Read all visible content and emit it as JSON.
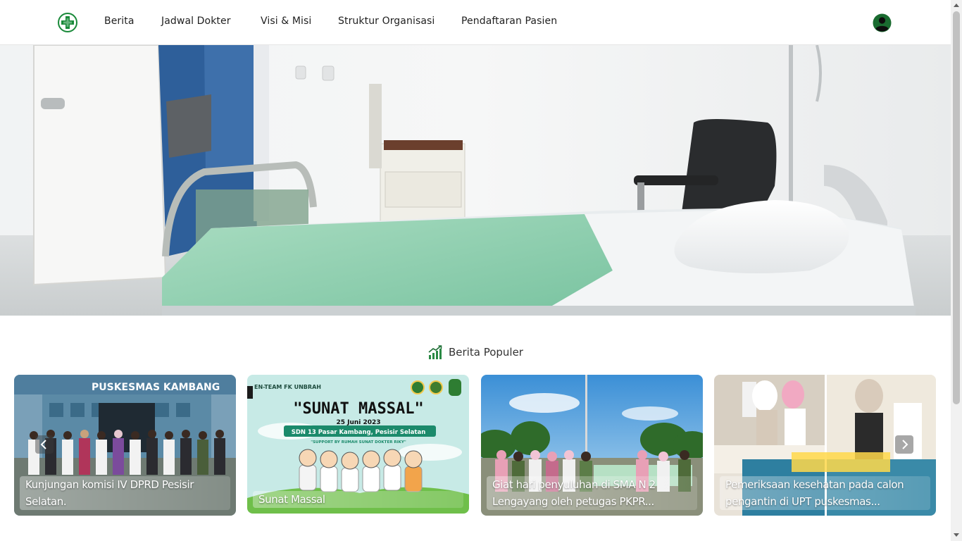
{
  "nav": {
    "logo_icon": "medical-cross-icon",
    "items": [
      "Berita",
      "Jadwal Dokter",
      "Visi & Misi",
      "Struktur Organisasi",
      "Pendaftaran Pasien"
    ],
    "avatar_icon": "user-avatar-icon",
    "brand_color": "#1a8a3a"
  },
  "hero": {
    "image": "hospital-room-photo"
  },
  "popular": {
    "icon": "trending-chart-icon",
    "title": "Berita Populer",
    "cards": [
      {
        "caption": "Kunjungan komisi IV DPRD Pesisir Selatan.",
        "image": "puskesmas-kambang-group-photo",
        "sign_text": "PUSKESMAS KAMBANG"
      },
      {
        "caption": "Sunat Massal",
        "image": "sunat-massal-poster",
        "poster": {
          "team": "EN-TEAM FK UNBRAH",
          "headline": "\"SUNAT MASSAL\"",
          "date": "25 Juni 2023",
          "location": "SDN 13 Pasar Kambang, Pesisir Selatan",
          "support": "\"SUPPORT BY RUMAH SUNAT DOKTER RIKY\""
        }
      },
      {
        "caption": "Giat hari penyuluhan di SMA N 2 Lengayang oleh petugas PKPR...",
        "image": "beach-group-photo"
      },
      {
        "caption": "Pemeriksaan kesehatan pada calon pengantin di UPT puskesmas...",
        "image": "health-check-photo"
      }
    ],
    "prev_icon": "chevron-left-icon",
    "next_icon": "chevron-right-icon"
  }
}
